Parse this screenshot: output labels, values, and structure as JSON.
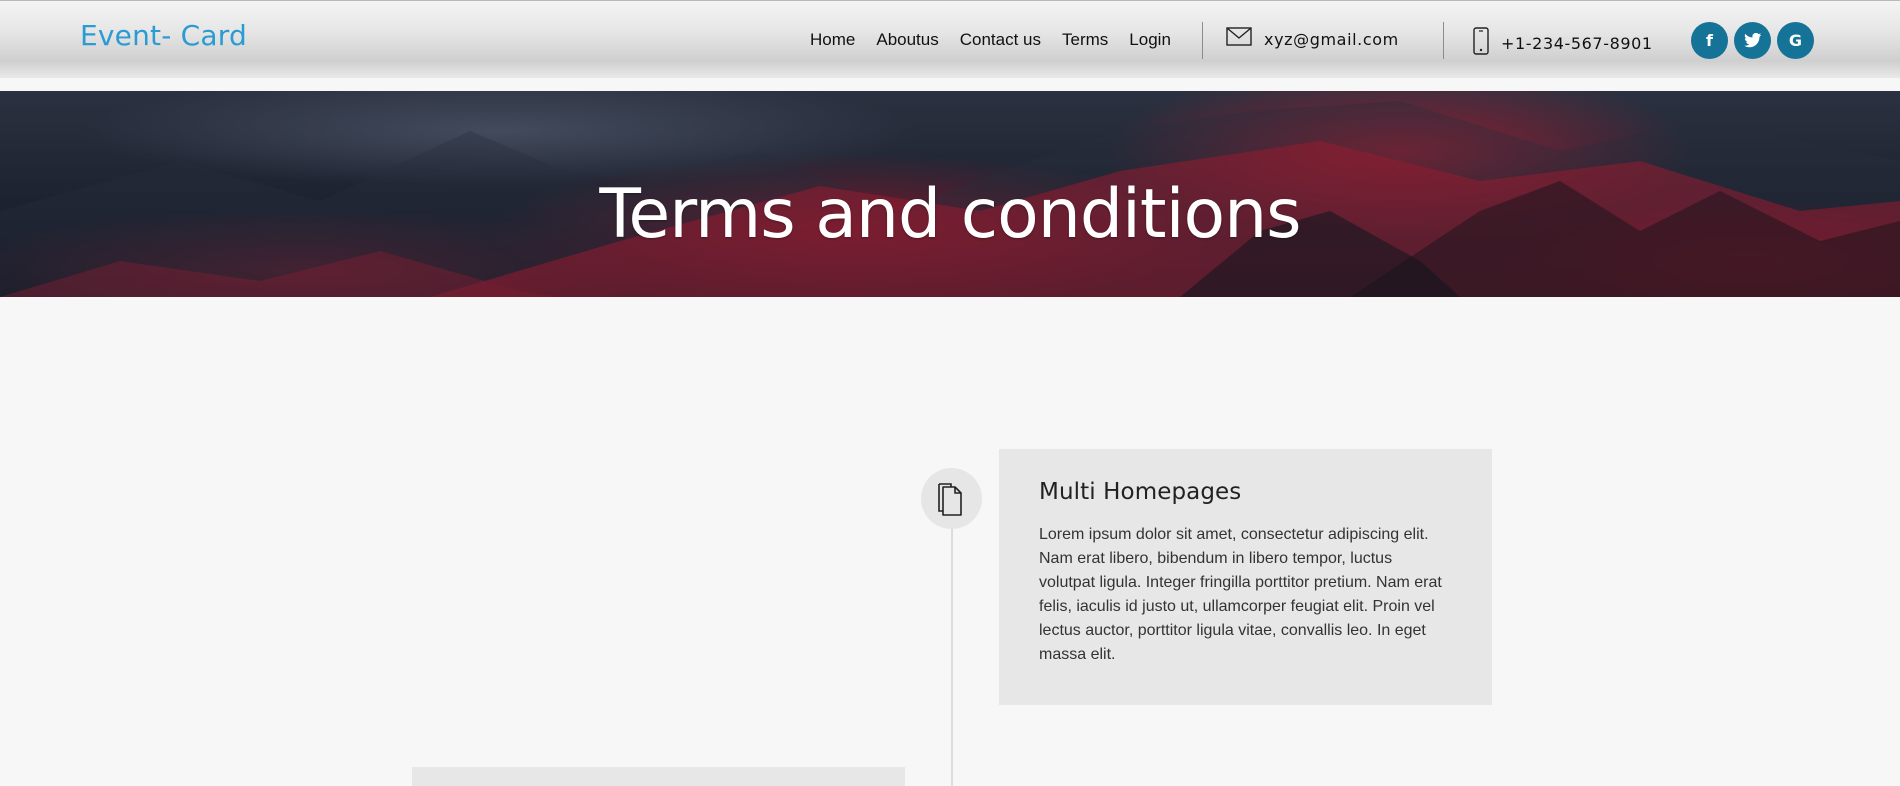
{
  "brand": {
    "name": "Event- Card",
    "color": "#2a9bd3"
  },
  "nav": {
    "items": [
      "Home",
      "Aboutus",
      "Contact us",
      "Terms",
      "Login"
    ]
  },
  "contact": {
    "email": "xyz@gmail.com",
    "email_icon": "envelope-icon",
    "phone": "+1-234-567-8901",
    "phone_icon": "mobile-phone-icon"
  },
  "social": [
    {
      "name": "facebook",
      "glyph": "f",
      "icon": "facebook-icon"
    },
    {
      "name": "twitter",
      "glyph": "t",
      "icon": "twitter-icon"
    },
    {
      "name": "google",
      "glyph": "G",
      "icon": "google-icon"
    }
  ],
  "social_color": "#157397",
  "hero": {
    "title": "Terms and conditions"
  },
  "timeline": {
    "items": [
      {
        "icon": "documents-icon",
        "title": "Multi Homepages",
        "body": "Lorem ipsum dolor sit amet, consectetur adipiscing elit. Nam erat libero, bibendum in libero tempor, luctus volutpat ligula. Integer fringilla porttitor pretium. Nam erat felis, iaculis id justo ut, ullamcorper feugiat elit. Proin vel lectus auctor, porttitor ligula vitae, convallis leo. In eget massa elit."
      }
    ]
  }
}
